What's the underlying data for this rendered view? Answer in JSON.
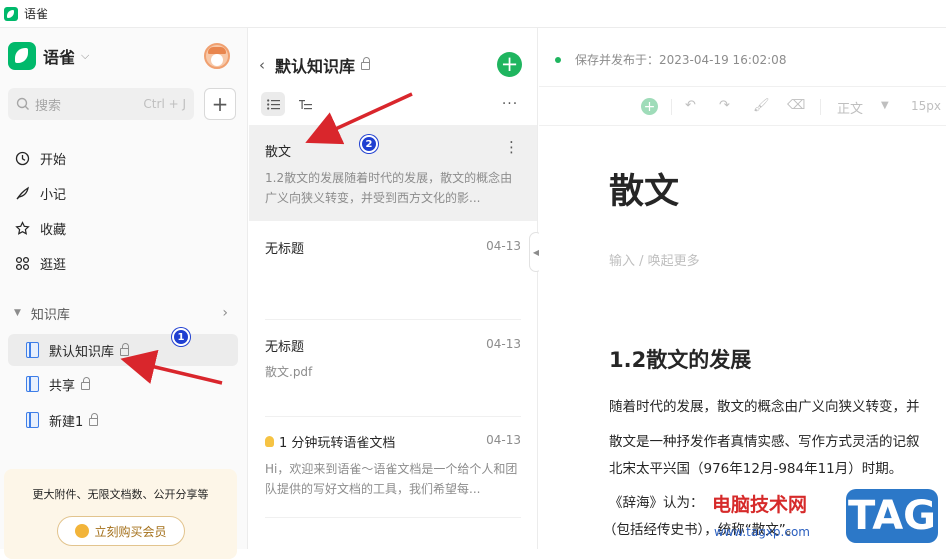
{
  "window": {
    "title": "语雀"
  },
  "sidebar": {
    "brand": "语雀",
    "search": {
      "placeholder": "搜索",
      "shortcut": "Ctrl + J"
    },
    "nav": [
      {
        "label": "开始",
        "icon": "clock-icon"
      },
      {
        "label": "小记",
        "icon": "feather-icon"
      },
      {
        "label": "收藏",
        "icon": "star-icon"
      },
      {
        "label": "逛逛",
        "icon": "grid-icon"
      }
    ],
    "knowledge_base_label": "知识库",
    "knowledge_bases": [
      {
        "label": "默认知识库",
        "locked": true,
        "active": true
      },
      {
        "label": "共享",
        "locked": true,
        "active": false
      },
      {
        "label": "新建1",
        "locked": true,
        "active": false
      }
    ],
    "promo": {
      "text": "更大附件、无限文档数、公开分享等",
      "button": "立刻购买会员"
    }
  },
  "doclist": {
    "title": "默认知识库",
    "docs": [
      {
        "title": "散文",
        "date": "",
        "snippet": "1.2散文的发展随着时代的发展，散文的概念由广义向狭义转变，并受到西方文化的影..."
      },
      {
        "title": "无标题",
        "date": "04-13",
        "snippet": ""
      },
      {
        "title": "无标题",
        "date": "04-13",
        "snippet": "散文.pdf"
      },
      {
        "title": "1 分钟玩转语雀文档",
        "date": "04-13",
        "snippet": "Hi，欢迎来到语雀～语雀文档是一个给个人和团队提供的写好文档的工具，我们希望每..."
      }
    ]
  },
  "editor": {
    "status": "保存并发布于：2023-04-19 16:02:08",
    "toolbar": {
      "style": "正文",
      "font_size": "15px"
    },
    "doc_title": "散文",
    "placeholder": "输入 / 唤起更多",
    "heading": "1.2散文的发展",
    "paragraphs": [
      "随着时代的发展，散文的概念由广义向狭义转变，并",
      "散文是一种抒发作者真情实感、写作方式灵活的记叙",
      "北宋太平兴国（976年12月-984年11月）时期。",
      "《辞海》认为：",
      "（包括经传史书），统称“散文”。"
    ]
  },
  "annotations": {
    "callout_1": "1",
    "callout_2": "2"
  },
  "watermark": {
    "text": "电脑技术网",
    "url": "www.tagxp.com",
    "tag": "TAG"
  },
  "colors": {
    "brand_green": "#00b96b",
    "arrow_red": "#d9262c",
    "callout_blue": "#1f3fd1"
  }
}
